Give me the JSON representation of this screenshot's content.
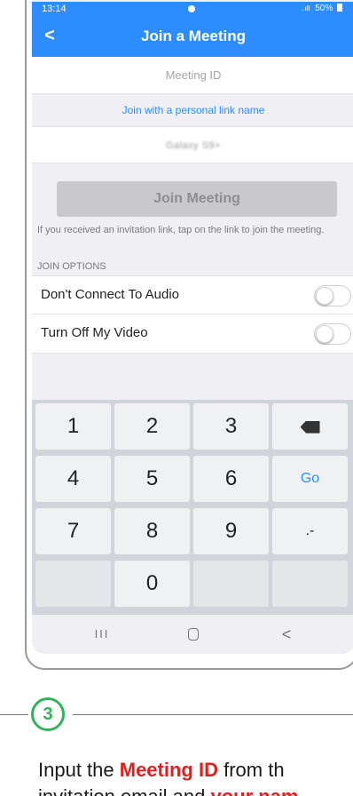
{
  "status_bar": {
    "time": "13:14",
    "signal": "..ıll",
    "battery": "50%"
  },
  "nav": {
    "title": "Join a Meeting",
    "back_label": "<"
  },
  "form": {
    "meeting_id_placeholder": "Meeting ID",
    "personal_link_label": "Join with a personal link name",
    "name_value": "Galaxy S9+",
    "join_button": "Join Meeting",
    "hint": "If you received an invitation link, tap on the link to join the meeting."
  },
  "join_options": {
    "section_label": "JOIN OPTIONS",
    "items": [
      {
        "label": "Don't Connect To Audio",
        "on": false
      },
      {
        "label": "Turn Off My Video",
        "on": false
      }
    ]
  },
  "keyboard": {
    "keys": [
      "1",
      "2",
      "3",
      "⌫",
      "4",
      "5",
      "6",
      "Go",
      "7",
      "8",
      "9",
      ".-",
      "",
      "0",
      ""
    ]
  },
  "system_nav": {
    "recent": "III",
    "back": "<"
  },
  "step": {
    "number": "3"
  },
  "instruction": {
    "line1_prefix": "Input the ",
    "line1_bold": "Meeting ID",
    "line1_suffix": " from th",
    "line2_prefix": "invitation email and ",
    "line2_bold": "your nam"
  },
  "colors": {
    "accent": "#2d8cff",
    "step_green": "#2fb45a",
    "highlight_red": "#e02020"
  }
}
